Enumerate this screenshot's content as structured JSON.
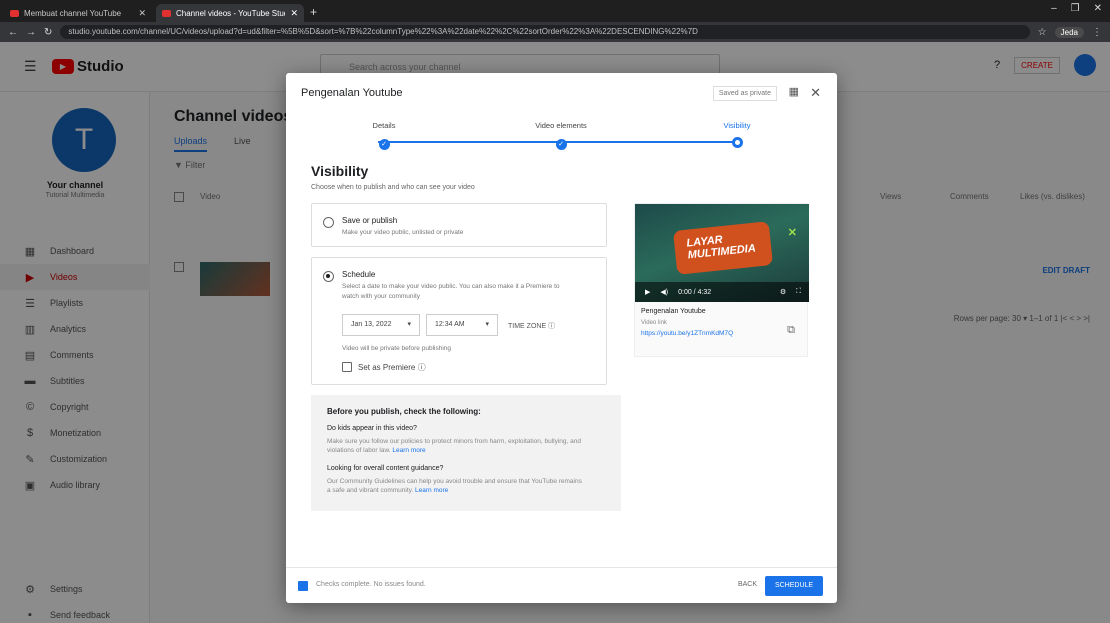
{
  "browser": {
    "tabs": [
      {
        "label": "Membuat channel YouTube"
      },
      {
        "label": "Channel videos - YouTube Studio"
      }
    ],
    "url": "studio.youtube.com/channel/UC/videos/upload?d=ud&filter=%5B%5D&sort=%7B%22columnType%22%3A%22date%22%2C%22sortOrder%22%3A%22DESCENDING%22%7D",
    "profile": "Jeda"
  },
  "studio": {
    "logo_text": "Studio",
    "search_placeholder": "Search across your channel",
    "create_label": "CREATE",
    "channel": {
      "initial": "T",
      "title": "Your channel",
      "subtitle": "Tutorial Multimedia"
    },
    "nav": [
      {
        "label": "Dashboard",
        "icon": "dashboard-icon",
        "glyph": "▦"
      },
      {
        "label": "Videos",
        "icon": "videos-icon",
        "glyph": "▶"
      },
      {
        "label": "Playlists",
        "icon": "playlists-icon",
        "glyph": "☰"
      },
      {
        "label": "Analytics",
        "icon": "analytics-icon",
        "glyph": "▥"
      },
      {
        "label": "Comments",
        "icon": "comments-icon",
        "glyph": "▤"
      },
      {
        "label": "Subtitles",
        "icon": "subtitles-icon",
        "glyph": "▬"
      },
      {
        "label": "Copyright",
        "icon": "copyright-icon",
        "glyph": "©"
      },
      {
        "label": "Monetization",
        "icon": "monetization-icon",
        "glyph": "$"
      },
      {
        "label": "Customization",
        "icon": "customization-icon",
        "glyph": "✎"
      },
      {
        "label": "Audio library",
        "icon": "audio-library-icon",
        "glyph": "▣"
      }
    ],
    "nav_bottom": [
      {
        "label": "Settings",
        "icon": "settings-icon",
        "glyph": "⚙"
      },
      {
        "label": "Send feedback",
        "icon": "feedback-icon",
        "glyph": "▪"
      }
    ],
    "content_title": "Channel videos",
    "tabs": [
      "Uploads",
      "Live"
    ],
    "filter_label": "Filter",
    "columns": [
      "Video",
      "Views",
      "Comments",
      "Likes (vs. dislikes)"
    ],
    "edit_draft": "EDIT DRAFT",
    "pager": "Rows per page: 30  ▾   1–1 of 1   |<  <  >  >|"
  },
  "modal": {
    "title": "Pengenalan Youtube",
    "saved_label": "Saved as private",
    "steps": [
      {
        "label": "Details"
      },
      {
        "label": "Video elements"
      },
      {
        "label": "Visibility"
      }
    ],
    "visibility_title": "Visibility",
    "visibility_sub": "Choose when to publish and who can see your video",
    "save_or_publish": {
      "title": "Save or publish",
      "desc": "Make your video public, unlisted or private"
    },
    "schedule": {
      "title": "Schedule",
      "desc": "Select a date to make your video public. You can also make it a Premiere to watch with your community",
      "date": "Jan 13, 2022",
      "time": "12:34 AM",
      "timezone": "TIME ZONE",
      "note": "Video will be private before publishing",
      "premiere_label": "Set as Premiere"
    },
    "info": {
      "heading": "Before you publish, check the following:",
      "q1": "Do kids appear in this video?",
      "p1": "Make sure you follow our policies to protect minors from harm, exploitation, bullying, and violations of labor law.",
      "learn1": "Learn more",
      "q2": "Looking for overall content guidance?",
      "p2": "Our Community Guidelines can help you avoid trouble and ensure that YouTube remains a safe and vibrant community.",
      "learn2": "Learn more"
    },
    "preview": {
      "art_line1": "LAYAR",
      "art_line2": "MULTIMEDIA",
      "time": "0:00 / 4:32",
      "title": "Pengenalan Youtube",
      "link_label": "Video link",
      "link": "https://youtu.be/y1ZTnmKdM7Q"
    },
    "footer_status": "Checks complete. No issues found.",
    "back_label": "BACK",
    "save_label": "SCHEDULE"
  }
}
